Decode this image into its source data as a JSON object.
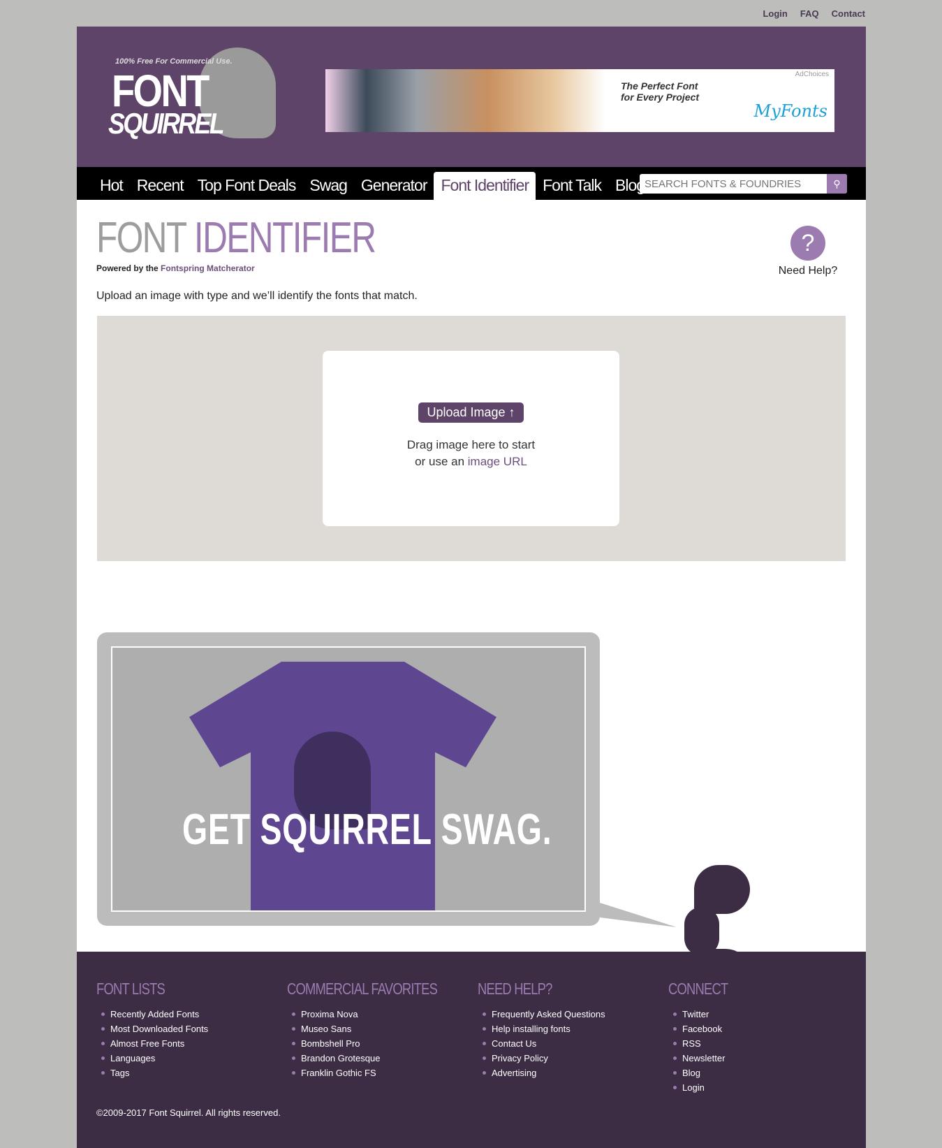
{
  "top_links": [
    "Login",
    "FAQ",
    "Contact"
  ],
  "logo": {
    "tagline": "100% Free For Commercial Use.",
    "word1": "FONT",
    "word2": "SQUIRREL"
  },
  "ad": {
    "adchoices": "AdChoices",
    "headline_1": "The Perfect Font",
    "headline_2": "for Every Project",
    "brand": "MyFonts"
  },
  "nav": {
    "items": [
      "Hot",
      "Recent",
      "Top Font Deals",
      "Swag",
      "Generator",
      "Font Identifier",
      "Font Talk",
      "Blog"
    ],
    "active": "Font Identifier",
    "search_placeholder": "SEARCH FONTS & FOUNDRIES"
  },
  "page": {
    "title_1": "FONT",
    "title_2": "IDENTIFIER",
    "powered_prefix": "Powered by the",
    "powered_link": "Fontspring Matcherator",
    "help_label": "Need Help?",
    "help_icon": "?",
    "intro": "Upload an image with type and we’ll identify the fonts that match."
  },
  "upload": {
    "button": "Upload Image",
    "button_icon": "↑",
    "drag_text": "Drag image here to start",
    "or_text": "or use an",
    "url_link": "image URL"
  },
  "swag": {
    "text": "GET SQUIRREL SWAG."
  },
  "footer": {
    "columns": [
      {
        "title": "FONT LISTS",
        "items": [
          "Recently Added Fonts",
          "Most Downloaded Fonts",
          "Almost Free Fonts",
          "Languages",
          "Tags"
        ]
      },
      {
        "title": "COMMERCIAL FAVORITES",
        "items": [
          "Proxima Nova",
          "Museo Sans",
          "Bombshell Pro",
          "Brandon Grotesque",
          "Franklin Gothic FS"
        ]
      },
      {
        "title": "NEED HELP?",
        "items": [
          "Frequently Asked Questions",
          "Help installing fonts",
          "Contact Us",
          "Privacy Policy",
          "Advertising"
        ]
      },
      {
        "title": "CONNECT",
        "items": [
          "Twitter",
          "Facebook",
          "RSS",
          "Newsletter",
          "Blog",
          "Login"
        ]
      }
    ],
    "copyright": "©2009-2017 Font Squirrel. All rights reserved."
  },
  "colors": {
    "brand_purple": "#5f4469",
    "accent_lavender": "#9b7bb0",
    "footer_bg": "#3c2d44"
  }
}
